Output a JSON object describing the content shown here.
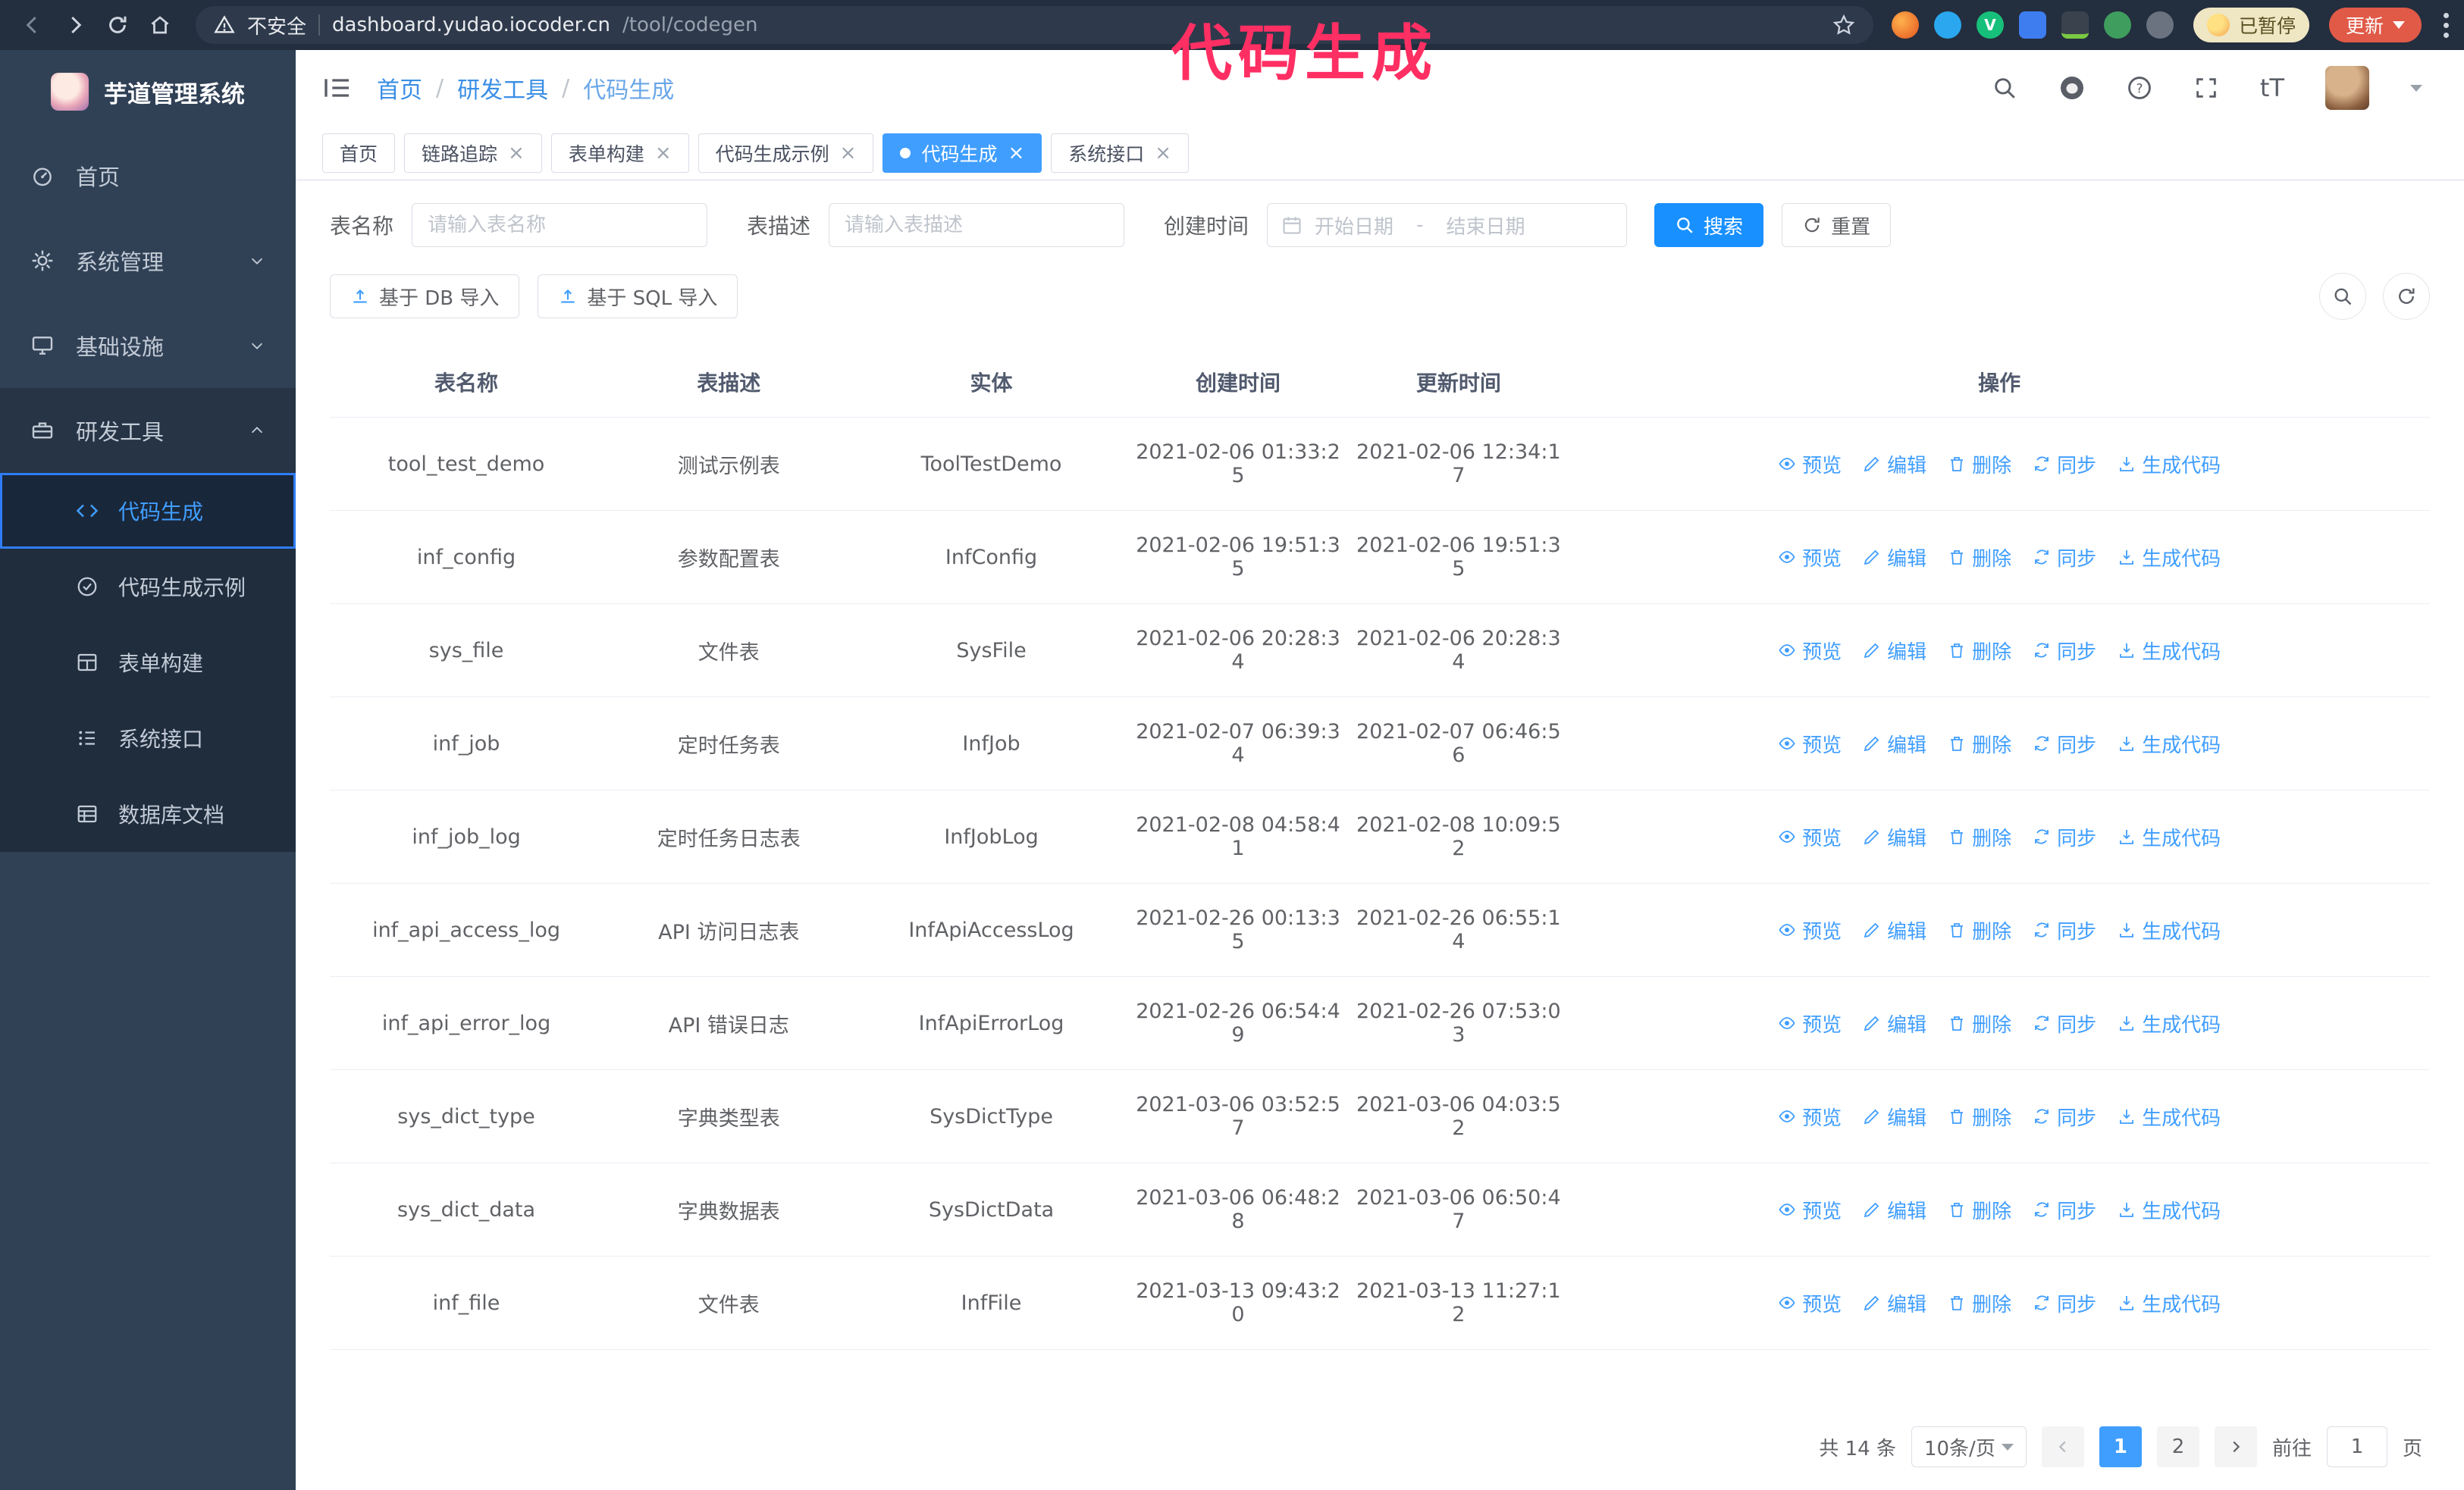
{
  "annotation": {
    "text": "代码生成",
    "color": "#ff2f63"
  },
  "browser": {
    "security_label": "不安全",
    "url_host": "dashboard.yudao.iocoder.cn",
    "url_path": "/tool/codegen",
    "paused_badge": "已暂停",
    "update_label": "更新"
  },
  "icons": {
    "close": "×",
    "font_size": "tT"
  },
  "sidebar": {
    "logo_title": "芋道管理系统",
    "items": [
      {
        "label": "首页"
      },
      {
        "label": "系统管理"
      },
      {
        "label": "基础设施"
      },
      {
        "label": "研发工具"
      }
    ],
    "submenu": [
      {
        "label": "代码生成"
      },
      {
        "label": "代码生成示例"
      },
      {
        "label": "表单构建"
      },
      {
        "label": "系统接口"
      },
      {
        "label": "数据库文档"
      }
    ]
  },
  "breadcrumb": {
    "separator": "/",
    "items": [
      "首页",
      "研发工具",
      "代码生成"
    ]
  },
  "tabs": [
    {
      "label": "首页"
    },
    {
      "label": "链路追踪"
    },
    {
      "label": "表单构建"
    },
    {
      "label": "代码生成示例"
    },
    {
      "label": "代码生成"
    },
    {
      "label": "系统接口"
    }
  ],
  "filters": {
    "name_label": "表名称",
    "name_placeholder": "请输入表名称",
    "desc_label": "表描述",
    "desc_placeholder": "请输入表描述",
    "time_label": "创建时间",
    "start_placeholder": "开始日期",
    "range_separator": "-",
    "end_placeholder": "结束日期",
    "search_label": "搜索",
    "reset_label": "重置"
  },
  "toolbar": {
    "import_db_label": "基于 DB 导入",
    "import_sql_label": "基于 SQL 导入"
  },
  "table": {
    "columns": [
      "表名称",
      "表描述",
      "实体",
      "创建时间",
      "更新时间",
      "操作"
    ],
    "actions": [
      "预览",
      "编辑",
      "删除",
      "同步",
      "生成代码"
    ],
    "rows": [
      {
        "name": "tool_test_demo",
        "desc": "测试示例表",
        "entity": "ToolTestDemo",
        "created": "2021-02-06 01:33:25",
        "updated": "2021-02-06 12:34:17"
      },
      {
        "name": "inf_config",
        "desc": "参数配置表",
        "entity": "InfConfig",
        "created": "2021-02-06 19:51:35",
        "updated": "2021-02-06 19:51:35"
      },
      {
        "name": "sys_file",
        "desc": "文件表",
        "entity": "SysFile",
        "created": "2021-02-06 20:28:34",
        "updated": "2021-02-06 20:28:34"
      },
      {
        "name": "inf_job",
        "desc": "定时任务表",
        "entity": "InfJob",
        "created": "2021-02-07 06:39:34",
        "updated": "2021-02-07 06:46:56"
      },
      {
        "name": "inf_job_log",
        "desc": "定时任务日志表",
        "entity": "InfJobLog",
        "created": "2021-02-08 04:58:41",
        "updated": "2021-02-08 10:09:52"
      },
      {
        "name": "inf_api_access_log",
        "desc": "API 访问日志表",
        "entity": "InfApiAccessLog",
        "created": "2021-02-26 00:13:35",
        "updated": "2021-02-26 06:55:14"
      },
      {
        "name": "inf_api_error_log",
        "desc": "API 错误日志",
        "entity": "InfApiErrorLog",
        "created": "2021-02-26 06:54:49",
        "updated": "2021-02-26 07:53:03"
      },
      {
        "name": "sys_dict_type",
        "desc": "字典类型表",
        "entity": "SysDictType",
        "created": "2021-03-06 03:52:57",
        "updated": "2021-03-06 04:03:52"
      },
      {
        "name": "sys_dict_data",
        "desc": "字典数据表",
        "entity": "SysDictData",
        "created": "2021-03-06 06:48:28",
        "updated": "2021-03-06 06:50:47"
      },
      {
        "name": "inf_file",
        "desc": "文件表",
        "entity": "InfFile",
        "created": "2021-03-13 09:43:20",
        "updated": "2021-03-13 11:27:12"
      }
    ]
  },
  "pagination": {
    "total_label": "共 14 条",
    "page_size_label": "10条/页",
    "pages": [
      "1",
      "2"
    ],
    "goto_label": "前往",
    "goto_value": "1",
    "unit_label": "页"
  }
}
